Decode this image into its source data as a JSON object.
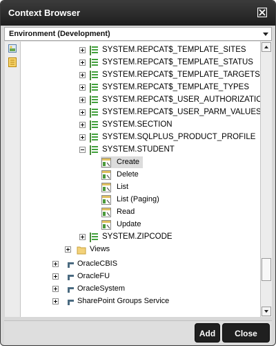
{
  "window": {
    "title": "Context Browser"
  },
  "environment": {
    "selected": "Environment (Development)"
  },
  "tree": {
    "items": [
      {
        "label": "SYSTEM.REPCAT$_TEMPLATE_SITES",
        "icon": "table-icon",
        "expander": "plus"
      },
      {
        "label": "SYSTEM.REPCAT$_TEMPLATE_STATUS",
        "icon": "table-icon",
        "expander": "plus"
      },
      {
        "label": "SYSTEM.REPCAT$_TEMPLATE_TARGETS",
        "icon": "table-icon",
        "expander": "plus"
      },
      {
        "label": "SYSTEM.REPCAT$_TEMPLATE_TYPES",
        "icon": "table-icon",
        "expander": "plus"
      },
      {
        "label": "SYSTEM.REPCAT$_USER_AUTHORIZATIO",
        "icon": "table-icon",
        "expander": "plus"
      },
      {
        "label": "SYSTEM.REPCAT$_USER_PARM_VALUES",
        "icon": "table-icon",
        "expander": "plus"
      },
      {
        "label": "SYSTEM.SECTION",
        "icon": "table-icon",
        "expander": "plus"
      },
      {
        "label": "SYSTEM.SQLPLUS_PRODUCT_PROFILE",
        "icon": "table-icon",
        "expander": "plus"
      },
      {
        "label": "SYSTEM.STUDENT",
        "icon": "table-icon",
        "expander": "minus"
      },
      {
        "label": "Create",
        "icon": "action-icon",
        "expander": "none"
      },
      {
        "label": "Delete",
        "icon": "action-icon",
        "expander": "none"
      },
      {
        "label": "List",
        "icon": "action-icon",
        "expander": "none"
      },
      {
        "label": "List (Paging)",
        "icon": "action-icon",
        "expander": "none"
      },
      {
        "label": "Read",
        "icon": "action-icon",
        "expander": "none"
      },
      {
        "label": "Update",
        "icon": "action-icon",
        "expander": "none"
      },
      {
        "label": "SYSTEM.ZIPCODE",
        "icon": "table-icon",
        "expander": "plus"
      },
      {
        "label": "Views",
        "icon": "folder-icon",
        "expander": "plus"
      },
      {
        "label": "OracleCBIS",
        "icon": "datasource-icon",
        "expander": "plus"
      },
      {
        "label": "OracleFU",
        "icon": "datasource-icon",
        "expander": "plus"
      },
      {
        "label": "OracleSystem",
        "icon": "datasource-icon",
        "expander": "plus"
      },
      {
        "label": "SharePoint Groups Service",
        "icon": "datasource-icon",
        "expander": "plus"
      }
    ],
    "selected": "Create"
  },
  "footer": {
    "add_label": "Add",
    "close_label": "Close"
  }
}
